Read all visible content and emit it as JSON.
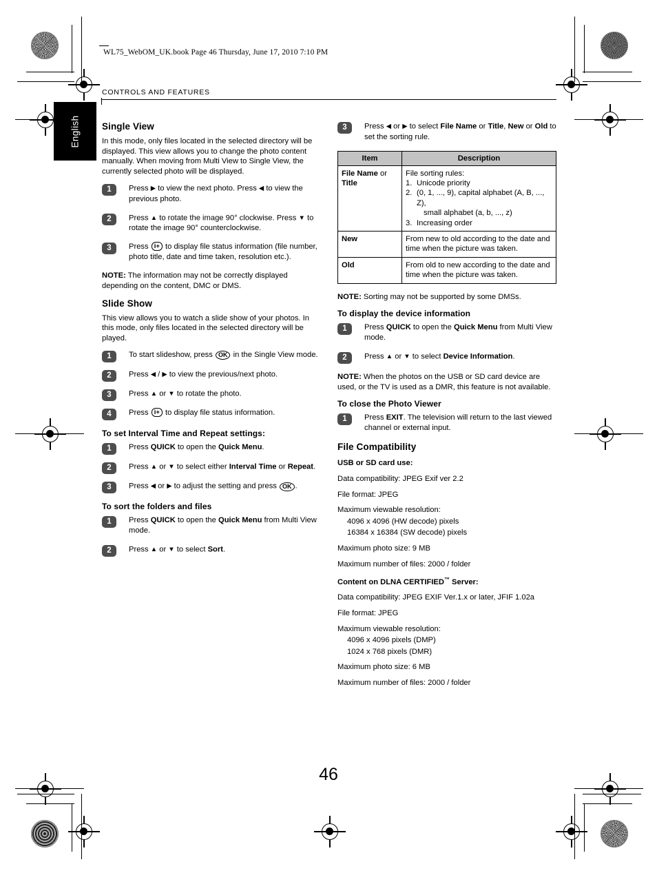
{
  "document": {
    "book_line": "WL75_WebOM_UK.book  Page 46  Thursday, June 17, 2010  7:10 PM",
    "running_head": "CONTROLS AND FEATURES",
    "language_tab": "English",
    "page_number": "46"
  },
  "left_column": {
    "single_view": {
      "heading": "Single View",
      "intro": "In this mode, only files located in the selected directory will be displayed. This view allows you to change the photo content manually. When moving from Multi View to Single View, the currently selected photo will be displayed.",
      "steps": [
        {
          "num": "1",
          "text_pre": "Press ",
          "arrow1": "▶",
          "text_mid": " to view the next photo. Press ",
          "arrow2": "◀",
          "text_post": " to view the previous photo."
        },
        {
          "num": "2",
          "text_pre": "Press ",
          "arrow1": "▲",
          "text_mid": " to rotate the image 90° clockwise. Press ",
          "arrow2": "▼",
          "text_post": " to rotate the image 90° counterclockwise."
        },
        {
          "num": "3",
          "text_pre": "Press ",
          "key": "i+",
          "text_post": " to display file status information (file number, photo title, date and time taken, resolution etc.)."
        }
      ],
      "note_label": "NOTE:",
      "note_text": " The information may not be correctly displayed depending on the content, DMC or DMS."
    },
    "slide_show": {
      "heading": "Slide Show",
      "intro": "This view allows you to watch a slide show of your photos. In this mode, only files located in the selected directory will be played.",
      "steps": [
        {
          "num": "1",
          "text_pre": "To start slideshow, press ",
          "key": "OK",
          "text_post": " in the Single View mode."
        },
        {
          "num": "2",
          "text_pre": "Press ",
          "arrow1": "◀",
          "text_mid": " / ",
          "arrow2": "▶",
          "text_post": " to view the previous/next photo."
        },
        {
          "num": "3",
          "text_pre": "Press ",
          "arrow1": "▲",
          "text_mid": " or ",
          "arrow2": "▼",
          "text_post": " to rotate the photo."
        },
        {
          "num": "4",
          "text_pre": "Press ",
          "key": "i+",
          "text_post": " to display file status information."
        }
      ]
    },
    "interval_repeat": {
      "heading": "To set Interval Time and Repeat settings:",
      "steps": [
        {
          "num": "1",
          "text": "Press QUICK to open the Quick Menu."
        },
        {
          "num": "2",
          "text": "Press ▲ or ▼ to select either Interval Time or Repeat."
        },
        {
          "num": "3",
          "text": "Press ◀ or ▶ to adjust the setting and press OK."
        }
      ],
      "b_quick": "QUICK",
      "b_quick_menu": "Quick Menu",
      "b_interval": "Interval Time",
      "b_repeat": "Repeat"
    },
    "sort_folders": {
      "heading": "To sort the folders and files",
      "steps": [
        {
          "num": "1",
          "text": "Press QUICK to open the Quick Menu from Multi View mode."
        },
        {
          "num": "2",
          "text": "Press ▲ or ▼ to select Sort."
        }
      ],
      "b_sort": "Sort"
    }
  },
  "right_column": {
    "sort_step3": {
      "num": "3",
      "text_pre": "Press ",
      "arrow1": "◀",
      "text_a": " or ",
      "arrow2": "▶",
      "text_b": " to select ",
      "b_filename": "File Name",
      "text_c": " or ",
      "b_title": "Title",
      "text_d": ", ",
      "b_new": "New",
      "text_e": " or ",
      "b_old": "Old",
      "text_post": " to set the sorting rule."
    },
    "sorting_table": {
      "headers": [
        "Item",
        "Description"
      ],
      "rows": [
        {
          "item_bold": "File Name",
          "item_reg": " or",
          "item_bold2": "Title",
          "desc_intro": "File sorting rules:",
          "desc_list": [
            {
              "n": "1.",
              "t": "Unicode priority"
            },
            {
              "n": "2.",
              "t": "(0, 1, ..., 9), capital alphabet (A, B, ..., Z),"
            },
            {
              "n": "",
              "t": "small alphabet (a, b, ..., z)",
              "sub": true
            },
            {
              "n": "3.",
              "t": "Increasing order"
            }
          ]
        },
        {
          "item_bold": "New",
          "desc": "From new to old according to the date and time when the picture was taken."
        },
        {
          "item_bold": "Old",
          "desc": "From old to new according to the date and time when the picture was taken."
        }
      ]
    },
    "note_sorting_label": "NOTE:",
    "note_sorting_text": " Sorting may not be supported by some DMSs.",
    "device_info": {
      "heading": "To display the device information",
      "steps": [
        {
          "num": "1",
          "text": "Press QUICK to open the Quick Menu from Multi View mode."
        },
        {
          "num": "2",
          "text": "Press ▲ or ▼ to select Device Information."
        }
      ],
      "b_quick": "QUICK",
      "b_quick_menu": "Quick Menu",
      "b_device_info": "Device Information",
      "note_label": "NOTE:",
      "note_text": " When the photos on the USB or SD card device are used, or the TV is used as a DMR, this feature is not available."
    },
    "close_viewer": {
      "heading": "To close the Photo Viewer",
      "steps": [
        {
          "num": "1",
          "text": "Press EXIT. The television will return to the last viewed channel or external input."
        }
      ],
      "b_exit": "EXIT"
    },
    "file_compatibility": {
      "heading": "File Compatibility",
      "usb_heading": "USB or SD card use:",
      "usb_lines": [
        "Data compatibility: JPEG Exif ver 2.2",
        "File format: JPEG",
        "Maximum viewable resolution:",
        "4096 x 4096 (HW decode) pixels",
        "16384 x 16384 (SW decode) pixels",
        "Maximum photo size: 9 MB",
        "Maximum number of files: 2000 / folder"
      ],
      "dlna_heading_pre": "Content on DLNA CERTIFIED",
      "dlna_heading_tm": "™",
      "dlna_heading_post": " Server:",
      "dlna_lines": [
        "Data compatibility: JPEG EXIF Ver.1.x or later, JFIF 1.02a",
        "File format: JPEG",
        "Maximum viewable resolution:",
        "4096 x 4096 pixels (DMP)",
        "1024 x 768 pixels (DMR)",
        "Maximum photo size: 6 MB",
        "Maximum number of files: 2000 / folder"
      ]
    }
  }
}
